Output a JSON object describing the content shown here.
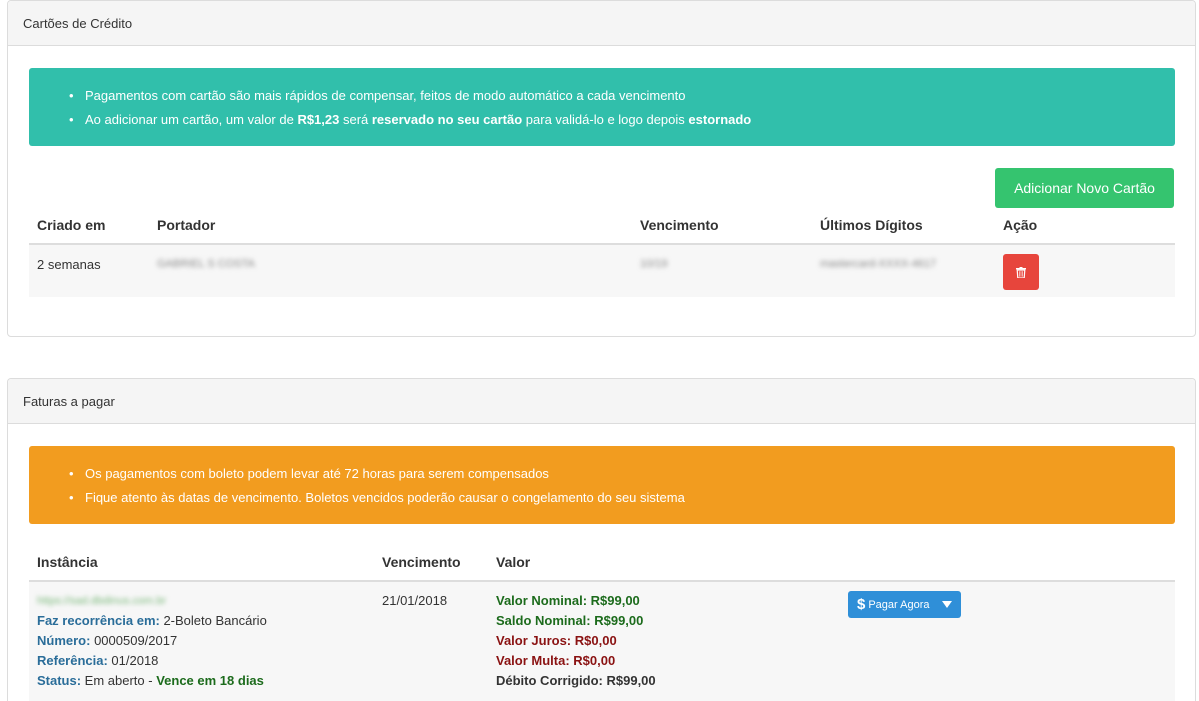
{
  "cards_panel": {
    "title": "Cartões de Crédito",
    "alert": {
      "line1": "Pagamentos com cartão são mais rápidos de compensar, feitos de modo automático a cada vencimento",
      "line2_a": "Ao adicionar um cartão, um valor de ",
      "line2_b": "R$1,23",
      "line2_c": " será ",
      "line2_d": "reservado no seu cartão",
      "line2_e": " para validá-lo e logo depois ",
      "line2_f": "estornado"
    },
    "add_button": "Adicionar Novo Cartão",
    "columns": [
      "Criado em",
      "Portador",
      "Vencimento",
      "Últimos Dígitos",
      "Ação"
    ],
    "rows": [
      {
        "created": "2 semanas",
        "holder": "GABRIEL S COSTA",
        "expiry": "10/19",
        "last_digits": "mastercard-XXXX-4617"
      }
    ]
  },
  "invoices_panel": {
    "title": "Faturas a pagar",
    "alert": {
      "line1": "Os pagamentos com boleto podem levar até 72 horas para serem compensados",
      "line2": "Fique atento às datas de vencimento. Boletos vencidos poderão causar o congelamento do seu sistema"
    },
    "columns": [
      "Instância",
      "Vencimento",
      "Valor"
    ],
    "invoice": {
      "instance_url": "https://sad.dbdinus.com.br",
      "recurrence_label": "Faz recorrência em:",
      "recurrence_value": " 2-Boleto Bancário",
      "number_label": "Número:",
      "number_value": " 0000509/2017",
      "reference_label": "Referência:",
      "reference_value": " 01/2018",
      "status_label": "Status:",
      "status_value": " Em aberto - ",
      "status_due": "Vence em 18 dias",
      "due_date": "21/01/2018",
      "valor_nominal": "Valor Nominal: R$99,00",
      "saldo_nominal": "Saldo Nominal: R$99,00",
      "valor_juros": "Valor Juros: R$0,00",
      "valor_multa": "Valor Multa: R$0,00",
      "debito_corrigido": "Débito Corrigido: R$99,00",
      "pay_button": "Pagar Agora"
    }
  },
  "colors": {
    "teal_alert": "#31bfab",
    "orange_alert": "#f29c1f",
    "add_button": "#35c46f",
    "delete_button": "#e7453c",
    "pay_button": "#2f8fd8"
  }
}
